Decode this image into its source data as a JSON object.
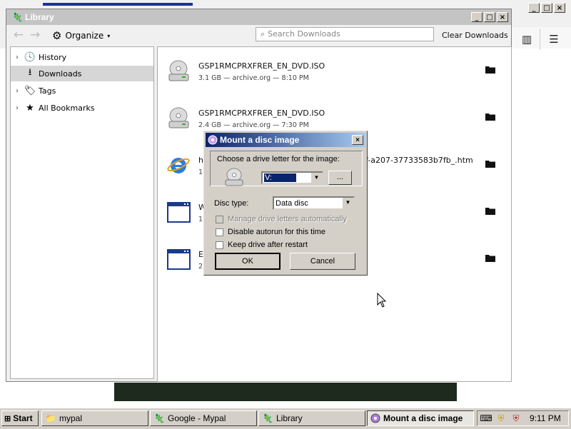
{
  "library_window": {
    "title": "Library",
    "organize_label": "Organize",
    "search_placeholder": "Search Downloads",
    "clear_downloads_label": "Clear Downloads"
  },
  "sidebar": {
    "items": [
      {
        "label": "History",
        "icon": "clock-icon"
      },
      {
        "label": "Downloads",
        "icon": "download-arrow-icon"
      },
      {
        "label": "Tags",
        "icon": "tag-icon"
      },
      {
        "label": "All Bookmarks",
        "icon": "star-icon"
      }
    ]
  },
  "downloads": [
    {
      "name": "GSP1RMCPRXFRER_EN_DVD.ISO",
      "meta": "3.1 GB — archive.org — 8:10 PM",
      "icon": "disc-drive-icon"
    },
    {
      "name": "GSP1RMCPRXFRER_EN_DVD.ISO",
      "meta": "2.4 GB — archive.org — 7:30 PM",
      "icon": "disc-drive-icon"
    },
    {
      "name": "h",
      "name_tail": "f-a207-37733583b7fb_.htm",
      "meta": "1",
      "icon": "internet-explorer-icon"
    },
    {
      "name": "W",
      "meta": "1",
      "icon": "window-icon"
    },
    {
      "name": "E",
      "meta": "2",
      "icon": "window-icon"
    }
  ],
  "dialog": {
    "title": "Mount a disc image",
    "choose_label": "Choose a drive letter for the image:",
    "drive_value": "V:",
    "browse_label": "...",
    "disc_type_label": "Disc type:",
    "disc_type_value": "Data disc",
    "options": [
      {
        "label": "Manage drive letters automatically",
        "checked": false,
        "disabled": true
      },
      {
        "label": "Disable autorun for this time",
        "checked": false,
        "disabled": false
      },
      {
        "label": "Keep drive after restart",
        "checked": false,
        "disabled": false
      }
    ],
    "ok_label": "OK",
    "cancel_label": "Cancel"
  },
  "taskbar": {
    "start_label": "Start",
    "tasks": [
      {
        "label": "mypal",
        "icon": "folder-icon"
      },
      {
        "label": "Google - Mypal",
        "icon": "mypal-icon"
      },
      {
        "label": "Library",
        "icon": "mypal-icon"
      },
      {
        "label": "Mount a disc image",
        "icon": "disc-image-icon",
        "active": true
      }
    ],
    "clock": "9:11 PM"
  }
}
